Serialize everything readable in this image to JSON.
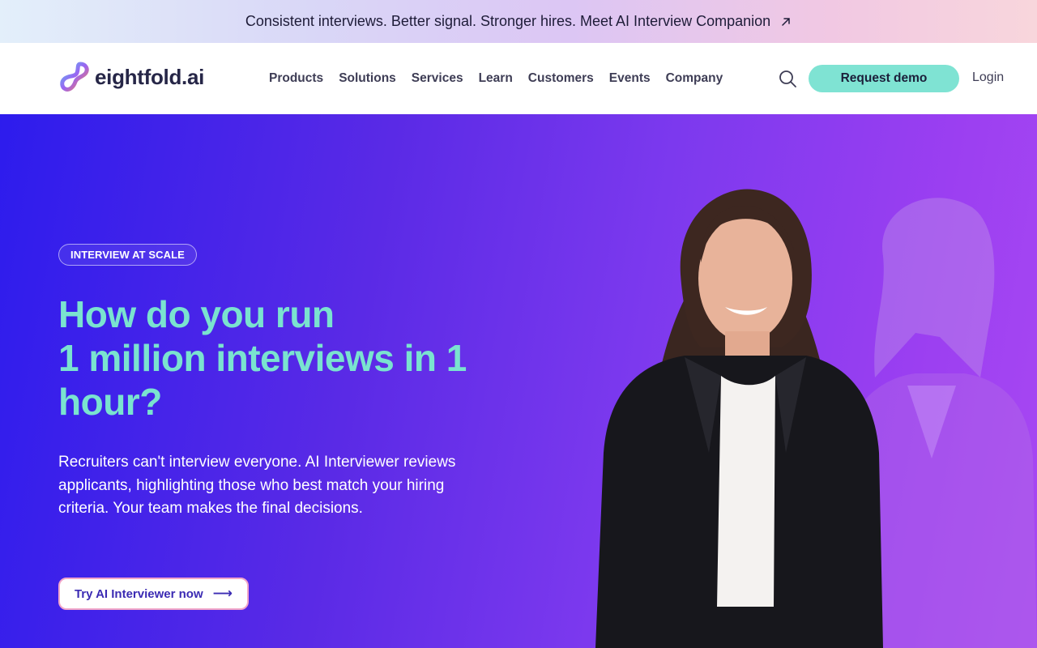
{
  "announcement": {
    "text": "Consistent interviews. Better signal. Stronger hires. Meet AI Interview Companion",
    "icon": "arrow-up-right-icon"
  },
  "nav": {
    "logo_text": "eightfold.ai",
    "menu": [
      "Products",
      "Solutions",
      "Services",
      "Learn",
      "Customers",
      "Events",
      "Company"
    ],
    "search_icon": "search-icon",
    "demo_label": "Request demo",
    "login_label": "Login"
  },
  "hero": {
    "badge": "INTERVIEW AT SCALE",
    "headline_line1": "How do you run",
    "headline_line2": "1 million interviews in 1 hour?",
    "body": "Recruiters can't interview everyone. AI Interviewer reviews applicants, highlighting those who best match your hiring criteria. Your team makes the final decisions.",
    "cta_label": "Try AI Interviewer now",
    "cta_icon": "arrow-right-icon"
  },
  "colors": {
    "accent_teal": "#7fe3d3",
    "headline": "#7ae3cf",
    "hero_start": "#2d1ced",
    "hero_end": "#a848f2"
  }
}
